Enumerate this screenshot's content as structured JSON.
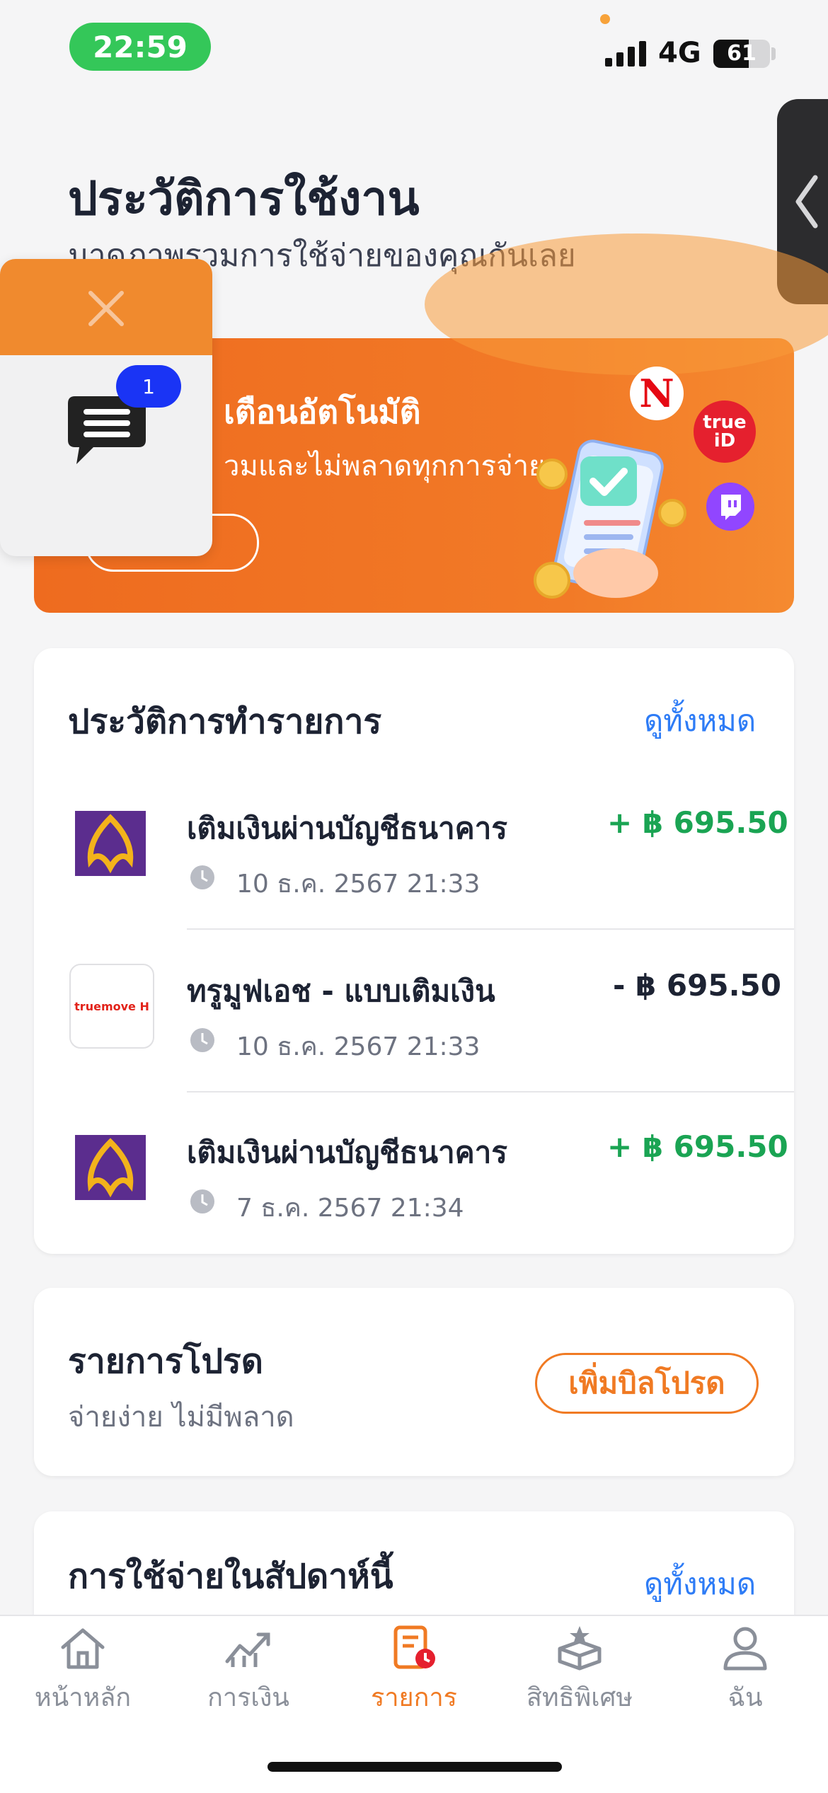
{
  "status_bar": {
    "time": "22:59",
    "network": "4G",
    "battery": "61"
  },
  "header": {
    "title": "ประวัติการใช้งาน",
    "subtitle": "มาดูภาพรวมการใช้จ่ายของคุณกันเลย"
  },
  "banner": {
    "title": "เตือนอัตโนมัติ",
    "subtitle": "วมและไม่พลาดทุกการจ่าย",
    "brand_badges": [
      "N",
      "true iD",
      "twitch"
    ]
  },
  "chat_overlay": {
    "badge_count": "1"
  },
  "transactions": {
    "section_title": "ประวัติการทำรายการ",
    "view_all": "ดูทั้งหมด",
    "items": [
      {
        "title": "เติมเงินผ่านบัญชีธนาคาร",
        "date": "10 ธ.ค. 2567 21:33",
        "amount": "+ ฿ 695.50",
        "logo": "bank"
      },
      {
        "title": "ทรูมูฟเอช - แบบเติมเงิน",
        "date": "10 ธ.ค. 2567 21:33",
        "amount": "- ฿ 695.50",
        "logo": "truemove H"
      },
      {
        "title": "เติมเงินผ่านบัญชีธนาคาร",
        "date": "7 ธ.ค. 2567 21:34",
        "amount": "+ ฿ 695.50",
        "logo": "bank"
      }
    ]
  },
  "favorites": {
    "title": "รายการโปรด",
    "subtitle": "จ่ายง่าย ไม่มีพลาด",
    "add_button": "เพิ่มบิลโปรด"
  },
  "weekly": {
    "title": "การใช้จ่ายในสัปดาห์นี้",
    "view_all": "ดูทั้งหมด"
  },
  "bottom_nav": {
    "items": [
      {
        "label": "หน้าหลัก",
        "icon": "home-icon"
      },
      {
        "label": "การเงิน",
        "icon": "chart-icon"
      },
      {
        "label": "รายการ",
        "icon": "receipt-icon",
        "active": true
      },
      {
        "label": "สิทธิพิเศษ",
        "icon": "gift-icon"
      },
      {
        "label": "ฉัน",
        "icon": "person-icon"
      }
    ]
  },
  "colors": {
    "accent": "#f07a23",
    "positive": "#1aa453",
    "link": "#2e7cf6"
  }
}
